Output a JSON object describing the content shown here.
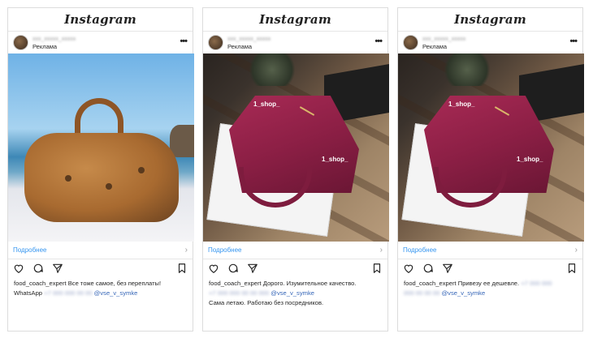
{
  "posts": [
    {
      "app_name": "Instagram",
      "sponsored_label": "Реклама",
      "more_label": "Подробнее",
      "caption_user": "food_coach_expert",
      "caption_text": "Все тоже самое, без переплаты!",
      "caption_line2_prefix": "WhatsApp",
      "caption_tag": "@vse_v_symke",
      "caption_line3": ""
    },
    {
      "app_name": "Instagram",
      "sponsored_label": "Реклама",
      "more_label": "Подробнее",
      "photo_watermark": "1_shop_",
      "caption_user": "food_coach_expert",
      "caption_text": "Дорого. Изумительное качество.",
      "caption_line2_prefix": "",
      "caption_tag": "@vse_v_symke",
      "caption_line3": "Сама летаю. Работаю без посредников."
    },
    {
      "app_name": "Instagram",
      "sponsored_label": "Реклама",
      "more_label": "Подробнее",
      "photo_watermark": "1_shop_",
      "caption_user": "food_coach_expert",
      "caption_text": "Привезу ее дешевле.",
      "caption_line2_prefix": "",
      "caption_tag": "@vse_v_symke",
      "caption_line3": ""
    }
  ],
  "icons": {
    "like": "heart-icon",
    "comment": "comment-icon",
    "share": "share-icon",
    "save": "bookmark-icon",
    "more": "more-dots-icon",
    "chevron": "chevron-right-icon"
  },
  "colors": {
    "link": "#3897f0",
    "tag": "#3767b8",
    "text": "#262626"
  }
}
